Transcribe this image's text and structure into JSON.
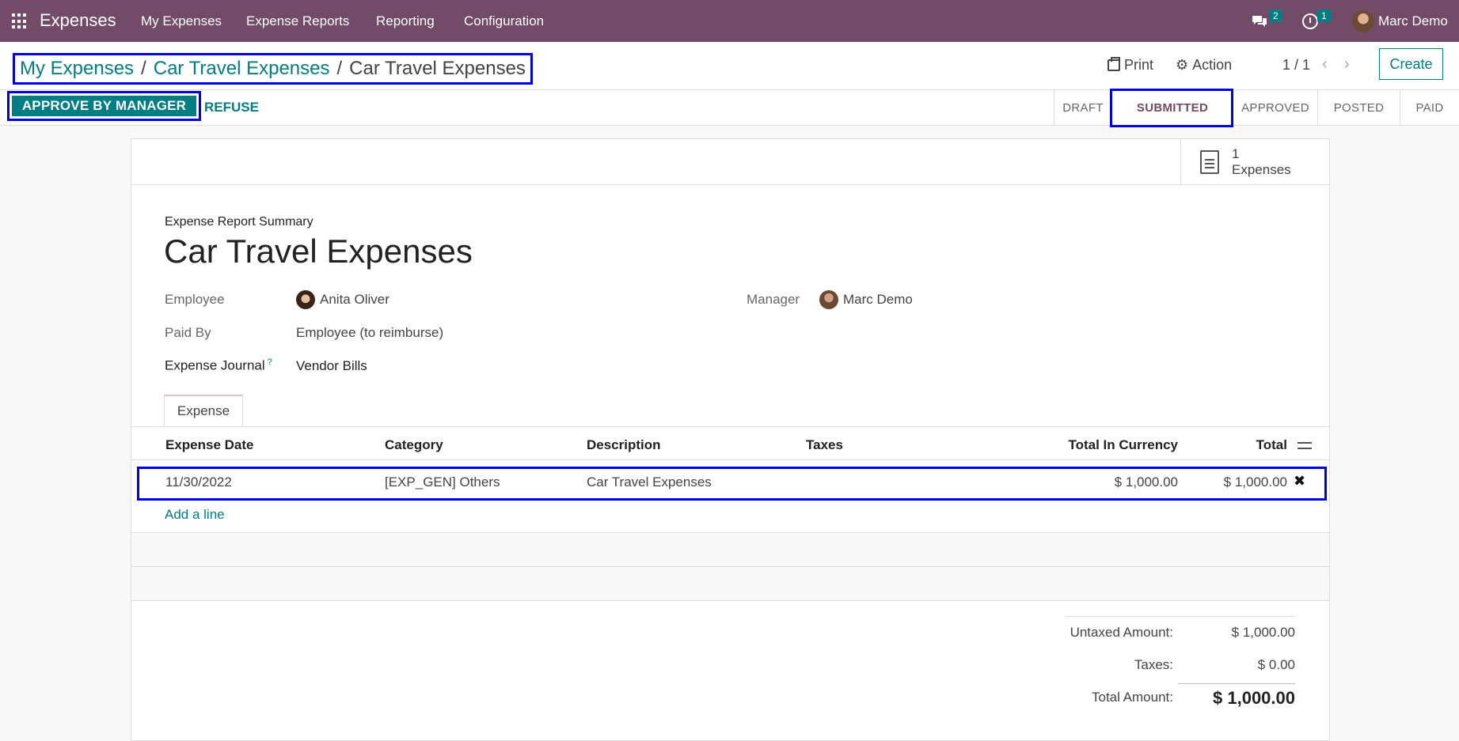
{
  "nav": {
    "app_name": "Expenses",
    "items": [
      "My Expenses",
      "Expense Reports",
      "Reporting",
      "Configuration"
    ],
    "chat_count": "2",
    "activity_count": "1",
    "user_name": "Marc Demo"
  },
  "breadcrumb": {
    "items": [
      "My Expenses",
      "Car Travel Expenses"
    ],
    "current": "Car Travel Expenses"
  },
  "toolbar": {
    "print_label": "Print",
    "action_label": "Action",
    "pager": "1 / 1",
    "create_label": "Create",
    "approve_label": "APPROVE BY MANAGER",
    "refuse_label": "REFUSE"
  },
  "status": {
    "steps": [
      "DRAFT",
      "SUBMITTED",
      "APPROVED",
      "POSTED",
      "PAID"
    ],
    "active": "SUBMITTED"
  },
  "smart_button": {
    "count": "1",
    "label": "Expenses"
  },
  "form": {
    "summary_label": "Expense Report Summary",
    "title": "Car Travel Expenses",
    "employee_label": "Employee",
    "employee_value": "Anita Oliver",
    "manager_label": "Manager",
    "manager_value": "Marc Demo",
    "paid_by_label": "Paid By",
    "paid_by_value": "Employee (to reimburse)",
    "journal_label": "Expense Journal",
    "journal_help": "?",
    "journal_value": "Vendor Bills"
  },
  "tabs": [
    "Expense"
  ],
  "table": {
    "columns": [
      "Expense Date",
      "Category",
      "Description",
      "Taxes",
      "Total In Currency",
      "Total"
    ],
    "rows": [
      [
        "11/30/2022",
        "[EXP_GEN] Others",
        "Car Travel Expenses",
        "",
        "$ 1,000.00",
        "$ 1,000.00"
      ]
    ],
    "add_line": "Add a line"
  },
  "totals": {
    "untaxed_label": "Untaxed Amount:",
    "untaxed_value": "$ 1,000.00",
    "taxes_label": "Taxes:",
    "taxes_value": "$ 0.00",
    "total_label": "Total Amount:",
    "total_value": "$ 1,000.00"
  },
  "colors": {
    "brand": "#714b67",
    "accent": "#017e84",
    "highlight": "#0000e6"
  }
}
